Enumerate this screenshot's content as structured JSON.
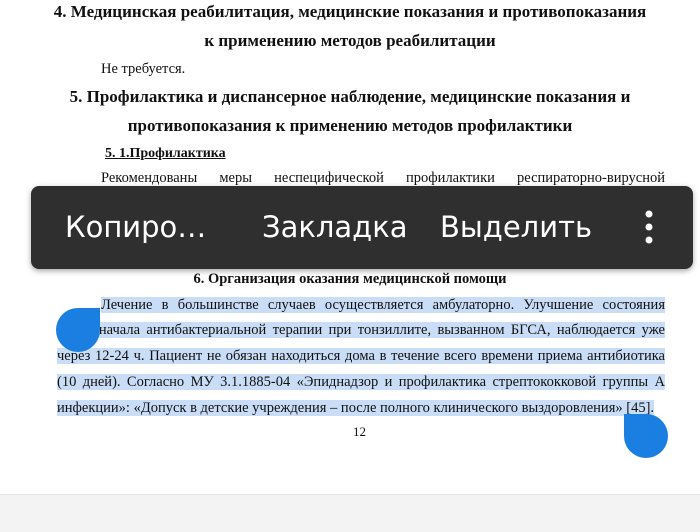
{
  "document": {
    "section4_heading_line1": "4. Медицинская реабилитация, медицинские показания и противопоказания",
    "section4_heading_line2": "к применению методов реабилитации",
    "section4_text": "Не требуется.",
    "section5_heading_line1": "5. Профилактика и диспансерное наблюдение, медицинские показания и",
    "section5_heading_line2": "противопоказания к применению методов профилактики",
    "subsection51_heading": "5. 1.Профилактика",
    "subsection51_words": [
      "Рекомендованы",
      "меры",
      "неспецифической",
      "профилактики",
      "респираторно-вирусной"
    ],
    "section6_heading": "6. Организация оказания медицинской помощи",
    "section6_paragraph_lines": [
      "Лечение в большинстве случаев осуществляется амбулаторно. Улучшение состояния",
      "после начала антибактериальной терапии при тонзиллите, вызванном БГСА, наблюдается уже",
      "через 12-24 ч. Пациент не обязан находиться дома в течение всего времени приема антибиотика",
      "(10 дней). Согласно МУ 3.1.1885-04 «Эпиднадзор и профилактика стрептококковой группы А",
      "инфекции»: «Допуск в детские учреждения – после полного клинического выздоровления» [45]."
    ],
    "page_number": "12"
  },
  "context_menu": {
    "copy_label": "Копиро…",
    "bookmark_label": "Закладка",
    "select_label": "Выделить",
    "more_icon": "more-vert-icon"
  },
  "colors": {
    "menu_background": "#2f2f2f",
    "menu_text": "#ffffff",
    "selection_highlight": "#c9ddf7",
    "selection_handle": "#1a7fe0"
  }
}
